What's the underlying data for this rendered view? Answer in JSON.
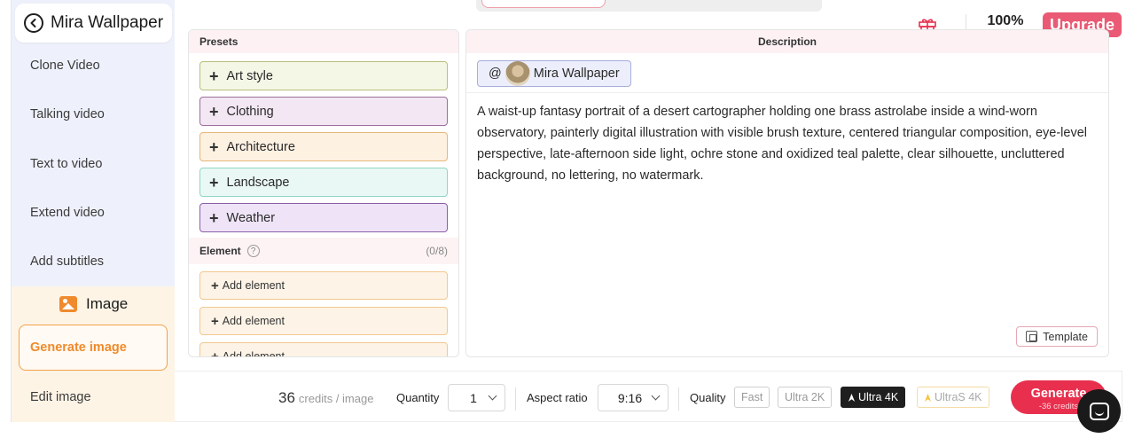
{
  "sidebar": {
    "back_title": "Mira Wallpaper",
    "items": [
      {
        "label": "Clone Video"
      },
      {
        "label": "Talking video"
      },
      {
        "label": "Text to video"
      },
      {
        "label": "Extend video"
      },
      {
        "label": "Add subtitles"
      }
    ],
    "section_label": "Image",
    "active_item": "Generate image",
    "sub_item": "Edit image"
  },
  "header": {
    "progress_text": "100%",
    "progress": 1.0,
    "upgrade_label": "Upgrade"
  },
  "presets": {
    "title": "Presets",
    "items": [
      {
        "label": "Art style",
        "bg": "#f4f6e6",
        "border": "#b9c07a"
      },
      {
        "label": "Clothing",
        "bg": "#f3e7f3",
        "border": "#9c6f9c"
      },
      {
        "label": "Architecture",
        "bg": "#fdf1e2",
        "border": "#e7b67a"
      },
      {
        "label": "Landscape",
        "bg": "#eaf8f5",
        "border": "#8fd6c4"
      },
      {
        "label": "Weather",
        "bg": "#efe4f7",
        "border": "#8a5fa9"
      }
    ],
    "element_title": "Element",
    "element_count": "(0/8)",
    "add_element_label": "Add element",
    "element_slots": [
      "Add element",
      "Add element",
      "Add element"
    ]
  },
  "description": {
    "title": "Description",
    "mention_at": "@",
    "mention_name": "Mira Wallpaper",
    "text": "A waist-up fantasy portrait of a desert cartographer holding one brass astrolabe inside a wind-worn observatory, painterly digital illustration with visible brush texture, centered triangular composition, eye-level perspective, late-afternoon side light, ochre stone and oxidized teal palette, clear silhouette, uncluttered background, no lettering, no watermark.",
    "template_label": "Template"
  },
  "bottom_bar": {
    "credits_value": "36",
    "credits_unit": "credits / image",
    "quantity_label": "Quantity",
    "quantity_value": "1",
    "aspect_label": "Aspect ratio",
    "aspect_value": "9:16",
    "quality_label": "Quality",
    "quality_options": [
      "Fast",
      "Ultra 2K",
      "Ultra 4K",
      "UltraS 4K"
    ],
    "quality_selected": "Ultra 4K",
    "generate_label": "Generate",
    "generate_cost": "-36 credits"
  },
  "icons": [
    "back-arrow-icon",
    "image-icon",
    "gift-icon",
    "plus-icon",
    "help-icon",
    "template-icon",
    "chevron-down-icon",
    "bolt-icon",
    "chat-icon"
  ],
  "colors": {
    "accent": "#e8304e",
    "upgrade": "#ea5a74",
    "image_orange": "#f08a2c"
  }
}
